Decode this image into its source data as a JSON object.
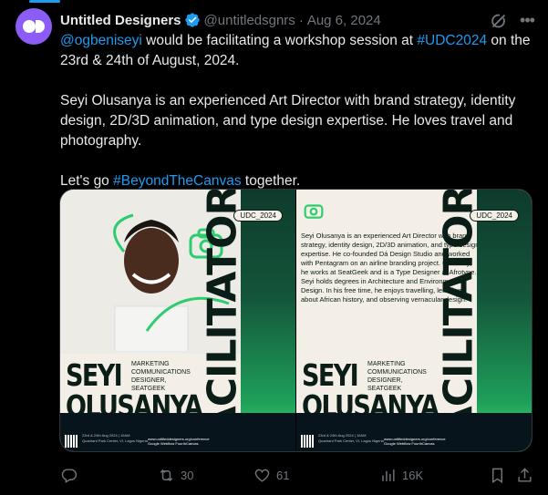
{
  "tweet": {
    "author_name": "Untitled Designers",
    "handle": "@untitledsgnrs",
    "separator": "·",
    "date": "Aug 6, 2024",
    "avatar_color": "#8b5cf6",
    "line1_mention": "@ogbeniseyi",
    "line1_text": " would be facilitating a workshop session at ",
    "line1_hashtag": "#UDC2024",
    "line1_tail": " on the 23rd & 24th of August, 2024.",
    "para2": "Seyi Olusanya is an experienced Art Director with brand strategy, identity design, 2D/3D animation, and type design expertise. He loves travel and photography.",
    "para3_prefix": "Let's go ",
    "para3_hashtag": "#BeyondTheCanvas",
    "para3_suffix": " together.",
    "link_color": "#1d9bf0"
  },
  "media": {
    "udc_tag": "UDC_2024",
    "vertical_title": "FACILITATOR",
    "first_name": "SEYI",
    "last_name": "OLUSANYA",
    "role": "MARKETING COMMUNICATIONS DESIGNER, SEATGEEK",
    "bio": "Seyi Olusanya is an experienced Art Director with brand strategy, identity design, 2D/3D animation, and type design expertise. He co-founded Dá Design Studio and worked with Pentagram on an airline branding project. Currently, he works at SeatGeek and is a Type Designer at Afrotype. Seyi holds degrees in Architecture and Environmental Design. In his free time, he enjoys travelling, learning about African history, and observing vernacular design.",
    "footer_line1": "23rd & 24th Aug 2024 | 10AM",
    "footer_line2": "Quadrant Park Center, VI, Lagos Nigeria",
    "footer_site": "www.untitleddesigners.org/conference",
    "sponsors": "Google  Webflow  FourthCanvas"
  },
  "actions": {
    "replies": "",
    "retweets": "30",
    "likes": "61",
    "views": "16K"
  },
  "icons": [
    "verified-badge-icon",
    "grok-icon",
    "more-icon",
    "reply-icon",
    "retweet-icon",
    "like-icon",
    "views-icon",
    "bookmark-icon",
    "share-icon"
  ]
}
